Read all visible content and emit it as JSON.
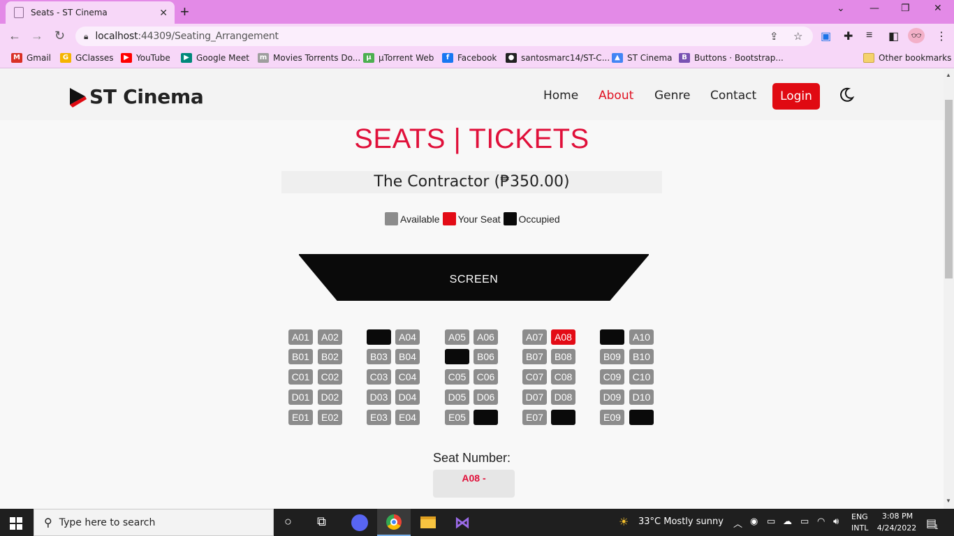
{
  "browser": {
    "tab_title": "Seats - ST Cinema",
    "tab_close": "✕",
    "new_tab": "+",
    "url_host": "localhost",
    "url_path": ":44309/Seating_Arrangement",
    "bookmarks": [
      {
        "label": "Gmail",
        "color": "#d93025",
        "glyph": "M"
      },
      {
        "label": "GClasses",
        "color": "#f5b400",
        "glyph": "G"
      },
      {
        "label": "YouTube",
        "color": "#ff0000",
        "glyph": "▶"
      },
      {
        "label": "Google Meet",
        "color": "#00897b",
        "glyph": "▶"
      },
      {
        "label": "Movies Torrents Do...",
        "color": "#9e9e9e",
        "glyph": "m"
      },
      {
        "label": "µTorrent Web",
        "color": "#4caf50",
        "glyph": "µ"
      },
      {
        "label": "Facebook",
        "color": "#1877f2",
        "glyph": "f"
      },
      {
        "label": "santosmarc14/ST-C...",
        "color": "#222222",
        "glyph": "●"
      },
      {
        "label": "ST Cinema",
        "color": "#4285f4",
        "glyph": "▲"
      },
      {
        "label": "Buttons · Bootstrap...",
        "color": "#7952b3",
        "glyph": "B"
      }
    ],
    "other_bookmarks": "Other bookmarks"
  },
  "nav": {
    "brand": "ST Cinema",
    "links": [
      "Home",
      "About",
      "Genre",
      "Contact"
    ],
    "active_link": "About",
    "login": "Login"
  },
  "page": {
    "heading": "SEATS | TICKETS",
    "movie": "The Contractor (₱350.00)",
    "legend": [
      {
        "label": "Available",
        "color": "#8c8c8c"
      },
      {
        "label": "Your Seat",
        "color": "#e30b16"
      },
      {
        "label": "Occupied",
        "color": "#0a0a0a"
      }
    ],
    "screen_label": "SCREEN",
    "seat_number_label": "Seat Number:",
    "seat_number_value": "A08 -"
  },
  "seats": {
    "rows": [
      "A",
      "B",
      "C",
      "D",
      "E"
    ],
    "columns": 10,
    "status": {
      "A": [
        "available",
        "available",
        "occupied",
        "available",
        "available",
        "available",
        "available",
        "selected",
        "occupied",
        "available"
      ],
      "B": [
        "available",
        "available",
        "available",
        "available",
        "occupied",
        "available",
        "available",
        "available",
        "available",
        "available"
      ],
      "C": [
        "available",
        "available",
        "available",
        "available",
        "available",
        "available",
        "available",
        "available",
        "available",
        "available"
      ],
      "D": [
        "available",
        "available",
        "available",
        "available",
        "available",
        "available",
        "available",
        "available",
        "available",
        "available"
      ],
      "E": [
        "available",
        "available",
        "available",
        "available",
        "available",
        "occupied",
        "available",
        "occupied",
        "available",
        "occupied"
      ]
    }
  },
  "taskbar": {
    "search_placeholder": "Type here to search",
    "weather": "33°C  Mostly sunny",
    "lang_top": "ENG",
    "lang_bottom": "INTL",
    "time": "3:08 PM",
    "date": "4/24/2022",
    "notification_count": "1"
  }
}
